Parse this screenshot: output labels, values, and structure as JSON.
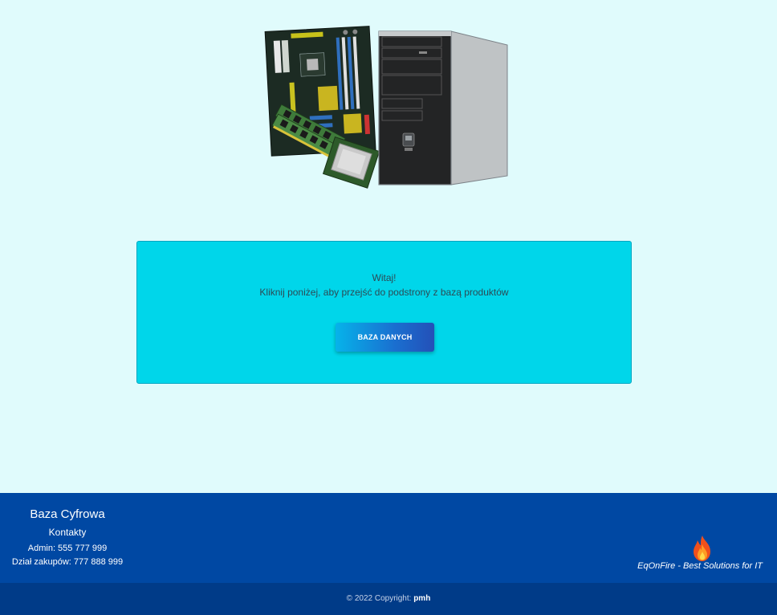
{
  "welcome": {
    "greeting": "Witaj!",
    "instruction": "Kliknij poniżej, aby przejść do podstrony z bazą produktów",
    "button_label": "BAZA DANYCH"
  },
  "footer": {
    "brand": "Baza Cyfrowa",
    "contacts_heading": "Kontakty",
    "admin_contact": "Admin: 555 777 999",
    "purchase_contact": "Dział zakupów: 777 888 999",
    "tagline": "EqOnFire - Best Solutions for IT"
  },
  "copyright": {
    "prefix": "© 2022 Copyright: ",
    "author": "pmh"
  },
  "icons": {
    "hero": "computer-hardware-illustration",
    "logo": "fire-icon"
  },
  "colors": {
    "page_background": "#e0fbfc",
    "card_background": "#00d6ea",
    "button_gradient_start": "#06b3ea",
    "button_gradient_end": "#2450b8",
    "footer_background": "#0048a3",
    "copyright_background": "#003b88"
  }
}
